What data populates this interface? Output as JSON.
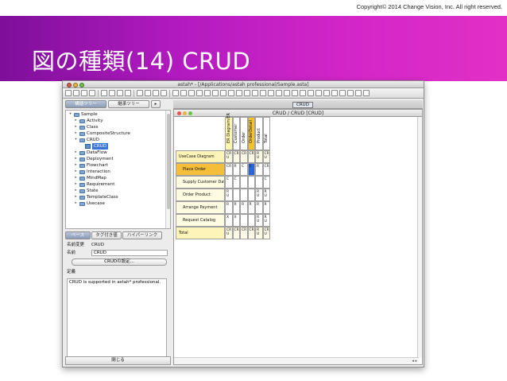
{
  "slide": {
    "copyright": "Copyright© 2014 Change Vision, Inc. All right reserved.",
    "title": "図の種類(14)  CRUD",
    "banner_gradient": [
      "#7e0f9a",
      "#e130c6"
    ]
  },
  "window": {
    "title": "astah* - [/Applications/astah professional/Sample.asta]",
    "toolbar_icons": [
      "new-file-icon",
      "open-icon",
      "save-icon",
      "print-icon",
      "undo-icon",
      "redo-icon",
      "zoom-in-icon",
      "zoom-out-icon",
      "fit-icon",
      "grid-icon",
      "align-icon",
      "color-icon",
      "font-icon",
      "line-icon",
      "settings-icon"
    ]
  },
  "left": {
    "tabs_top": [
      "構造ツリー",
      "継承ツリー"
    ],
    "tree": [
      {
        "label": "Sample",
        "depth": 0,
        "open": true,
        "icon": "folder"
      },
      {
        "label": "Activity",
        "depth": 1,
        "open": false,
        "icon": "folder"
      },
      {
        "label": "Class",
        "depth": 1,
        "open": false,
        "icon": "folder"
      },
      {
        "label": "CompositeStructure",
        "depth": 1,
        "open": false,
        "icon": "folder"
      },
      {
        "label": "CRUD",
        "depth": 1,
        "open": true,
        "icon": "folder"
      },
      {
        "label": "CRUD",
        "depth": 2,
        "open": null,
        "icon": "crud",
        "selected": true
      },
      {
        "label": "DataFlow",
        "depth": 1,
        "open": false,
        "icon": "folder"
      },
      {
        "label": "Deployment",
        "depth": 1,
        "open": false,
        "icon": "folder"
      },
      {
        "label": "Flowchart",
        "depth": 1,
        "open": false,
        "icon": "folder"
      },
      {
        "label": "Interaction",
        "depth": 1,
        "open": false,
        "icon": "folder"
      },
      {
        "label": "MindMap",
        "depth": 1,
        "open": false,
        "icon": "folder"
      },
      {
        "label": "Requirement",
        "depth": 1,
        "open": false,
        "icon": "folder"
      },
      {
        "label": "State",
        "depth": 1,
        "open": false,
        "icon": "folder"
      },
      {
        "label": "TemplateClass",
        "depth": 1,
        "open": false,
        "icon": "folder"
      },
      {
        "label": "Usecase",
        "depth": 1,
        "open": false,
        "icon": "folder"
      }
    ],
    "tabs_mid": [
      "ベース",
      "タグ付き値",
      "ハイパーリンク"
    ],
    "props": {
      "diagram_type_label": "名前変更",
      "diagram_type_value": "CRUD",
      "name_label": "名前",
      "name_value": "CRUD",
      "settings_button": "CRUDの設定...",
      "definition_label": "定義",
      "definition_value": "CRUD is supported in astah* professional."
    },
    "close_button": "閉じる"
  },
  "right": {
    "diagram_tab": "CRUD",
    "inner_title": "CRUD / CRUD [CRUD]"
  },
  "crud": {
    "columns": [
      "ER Diagram/ER",
      "Customer",
      "Order",
      "OrderDetail",
      "Product",
      "Total"
    ],
    "column_colors": [
      "#fff7b0",
      "#fff",
      "#fff",
      "#f2c22e",
      "#fff",
      "#fff"
    ],
    "rows": [
      {
        "label": "UseCase Diagram",
        "style": "yellow",
        "cells": [
          "CR\nU",
          "CR",
          "CR",
          "CR",
          "R\nU",
          "CR\nU"
        ]
      },
      {
        "label": "Place Order",
        "style": "orange",
        "cells": [
          "CR",
          "R",
          "C",
          "C",
          "R",
          "CR"
        ]
      },
      {
        "label": "Supply Customer Data",
        "style": "plain",
        "cells": [
          "C",
          "C",
          "",
          "",
          "",
          "C"
        ]
      },
      {
        "label": "Order Product",
        "style": "plain",
        "cells": [
          "R\nU",
          "",
          "",
          "",
          "R\nU",
          "R\nU"
        ]
      },
      {
        "label": "Arrange Payment",
        "style": "plain",
        "cells": [
          "R",
          "R",
          "R",
          "R",
          "R",
          "R"
        ]
      },
      {
        "label": "Request Catalog",
        "style": "plain",
        "cells": [
          "X",
          "X",
          "",
          "",
          "R\nU",
          "R\nU"
        ]
      },
      {
        "label": "Total",
        "style": "yellow",
        "cells": [
          "CR\nU",
          "CR",
          "CR",
          "CR",
          "R\nU",
          "CR\nU"
        ]
      }
    ],
    "highlight_cell": {
      "row": 1,
      "col": 3,
      "color": "#2a66d6"
    }
  }
}
